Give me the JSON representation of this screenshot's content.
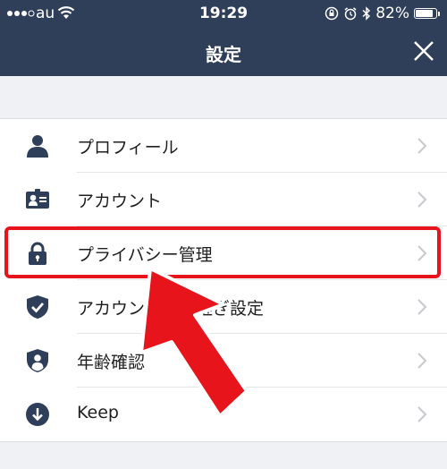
{
  "status_bar": {
    "carrier": "au",
    "time": "19:29",
    "battery": "82%"
  },
  "nav": {
    "title": "設定"
  },
  "settings": [
    {
      "label": "プロフィール",
      "icon": "person-icon"
    },
    {
      "label": "アカウント",
      "icon": "id-card-icon"
    },
    {
      "label": "プライバシー管理",
      "icon": "lock-icon"
    },
    {
      "label": "アカウント引き継ぎ設定",
      "icon": "shield-check-icon"
    },
    {
      "label": "年齢確認",
      "icon": "shield-person-icon"
    },
    {
      "label": "Keep",
      "icon": "keep-download-icon"
    }
  ],
  "colors": {
    "header": "#2f3e59",
    "icon": "#2f3e59",
    "highlight": "#e8141c",
    "background": "#f0f1f4"
  }
}
